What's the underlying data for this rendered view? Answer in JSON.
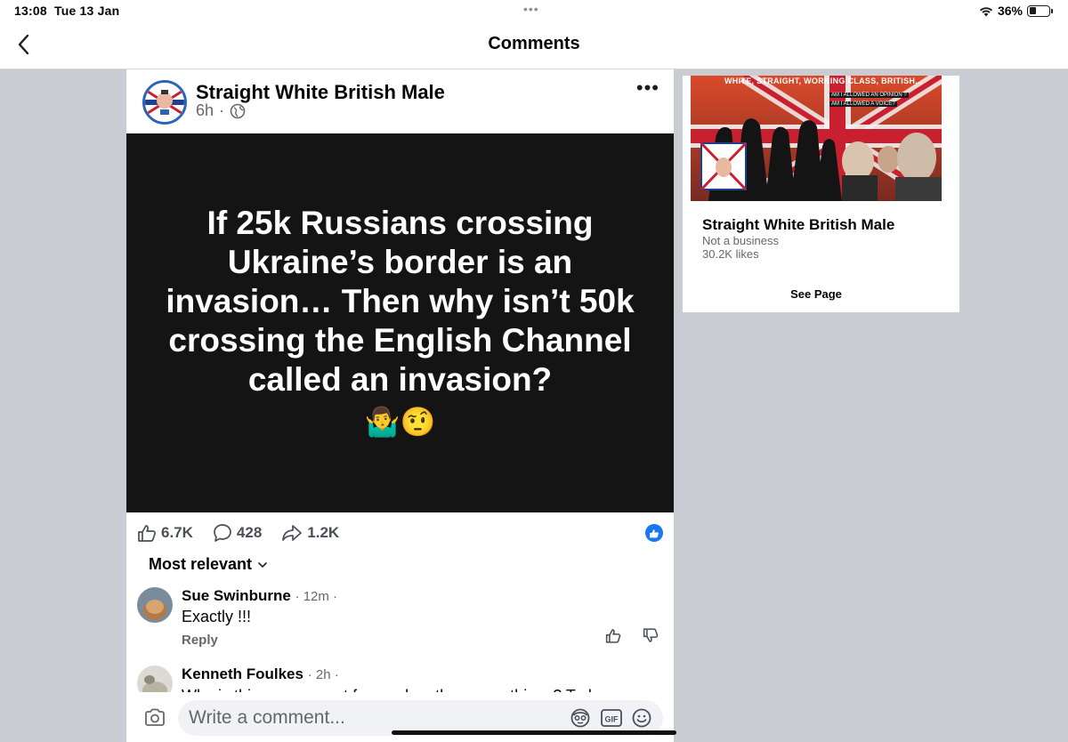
{
  "status_bar": {
    "time": "13:08",
    "date": "Tue 13 Jan",
    "battery": "36%",
    "battery_level": 0.36
  },
  "header": {
    "title": "Comments"
  },
  "post": {
    "author": "Straight White British Male",
    "time": "6h",
    "text": "If 25k Russians crossing Ukraine’s border is an invasion… Then why isn’t 50k crossing the English Channel called an invasion?",
    "emojis": "🤷‍♂️🤨",
    "reactions_count": "6.7K",
    "comments_count": "428",
    "shares_count": "1.2K"
  },
  "sort": {
    "label": "Most relevant"
  },
  "comments": [
    {
      "name": "Sue Swinburne",
      "time": "· 12m ·",
      "text": "Exactly !!!",
      "reply": "Reply"
    },
    {
      "name": "Kenneth Foulkes",
      "time": "· 2h ·",
      "text": "Why is this government focused on the wrong things? Today a"
    }
  ],
  "composer": {
    "placeholder": "Write a comment..."
  },
  "page_card": {
    "banner": "WHITE, STRAIGHT, WORKING CLASS, BRITISH...",
    "subline1": "AM I ALLOWED AN OPINION ?",
    "subline2": "AM I ALLOWED A VOICE?",
    "logo_text": "STRAIGHT WHITE BRITISH MALE",
    "name": "Straight White British Male",
    "category": "Not a business",
    "likes": "30.2K likes",
    "see_page": "See Page"
  },
  "colors": {
    "accent": "#1877f2",
    "background": "#c9cdd3",
    "post_image": "#141414"
  }
}
